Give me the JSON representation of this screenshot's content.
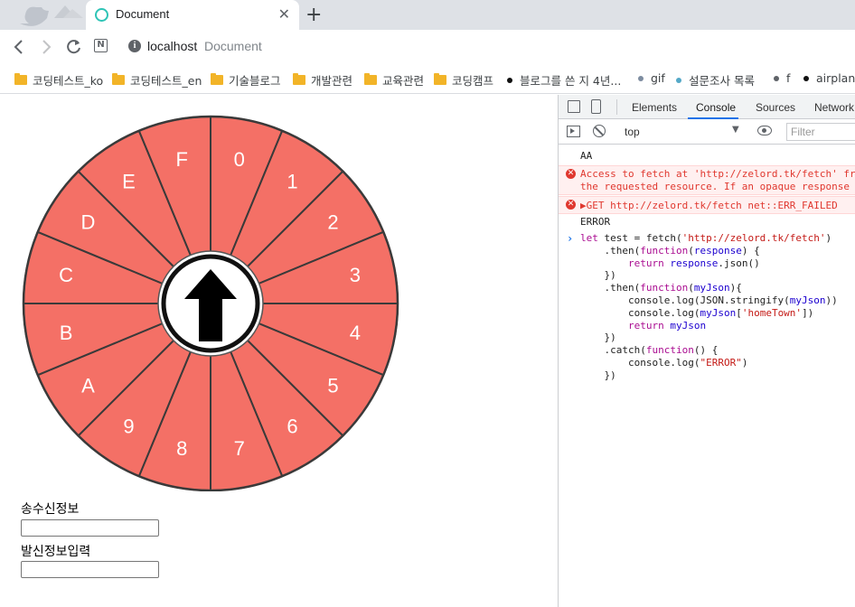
{
  "browser": {
    "tab_title": "Document",
    "tab_close": "✕",
    "new_tab": "+",
    "url_host": "localhost",
    "url_title": "Document",
    "nav_n_label": "N"
  },
  "bookmarks": [
    {
      "label": "코딩테스트_ko",
      "type": "folder"
    },
    {
      "label": "코딩테스트_en",
      "type": "folder"
    },
    {
      "label": "기술블로그",
      "type": "folder"
    },
    {
      "label": "개발관련",
      "type": "folder"
    },
    {
      "label": "교육관련",
      "type": "folder"
    },
    {
      "label": "코딩캠프",
      "type": "folder"
    },
    {
      "label": "블로그를 쓴 지 4년...",
      "type": "dot",
      "color": "#111111"
    },
    {
      "label": "gif",
      "type": "dot",
      "color": "#7d8ca0"
    },
    {
      "label": "설문조사 목록",
      "type": "dot",
      "color": "#54a8c7"
    },
    {
      "label": "f",
      "type": "dot",
      "color": "#5f6368"
    },
    {
      "label": "airplane",
      "type": "dot",
      "color": "#111111"
    }
  ],
  "wheel": {
    "segment_color": "#f47066",
    "labels_clockwise_from_top": [
      "0",
      "1",
      "2",
      "3",
      "4",
      "5",
      "6",
      "7",
      "8",
      "9",
      "A",
      "B",
      "C",
      "D",
      "E",
      "F"
    ]
  },
  "form": {
    "sender_label": "송수신정보",
    "sender_value": "",
    "input_label": "발신정보입력",
    "input_value": ""
  },
  "devtools": {
    "tabs": [
      "Elements",
      "Console",
      "Sources",
      "Network"
    ],
    "active_tab": "Console",
    "context": "top",
    "filter_placeholder": "Filter",
    "console": {
      "log_aa": "AA",
      "error1_line1": "Access to fetch at 'http://zelord.tk/fetch' fr",
      "error1_line2": "the requested resource. If an opaque response",
      "error2": "▶GET http://zelord.tk/fetch net::ERR_FAILED",
      "log_error": "ERROR",
      "code": [
        "let test = fetch('http://zelord.tk/fetch')",
        "    .then(function(response) {",
        "        return response.json()",
        "    })",
        "    .then(function(myJson){",
        "        console.log(JSON.stringify(myJson))",
        "        console.log(myJson['homeTown'])",
        "        return myJson",
        "    })",
        "    .catch(function() {",
        "        console.log(\"ERROR\")",
        "    })"
      ]
    }
  }
}
